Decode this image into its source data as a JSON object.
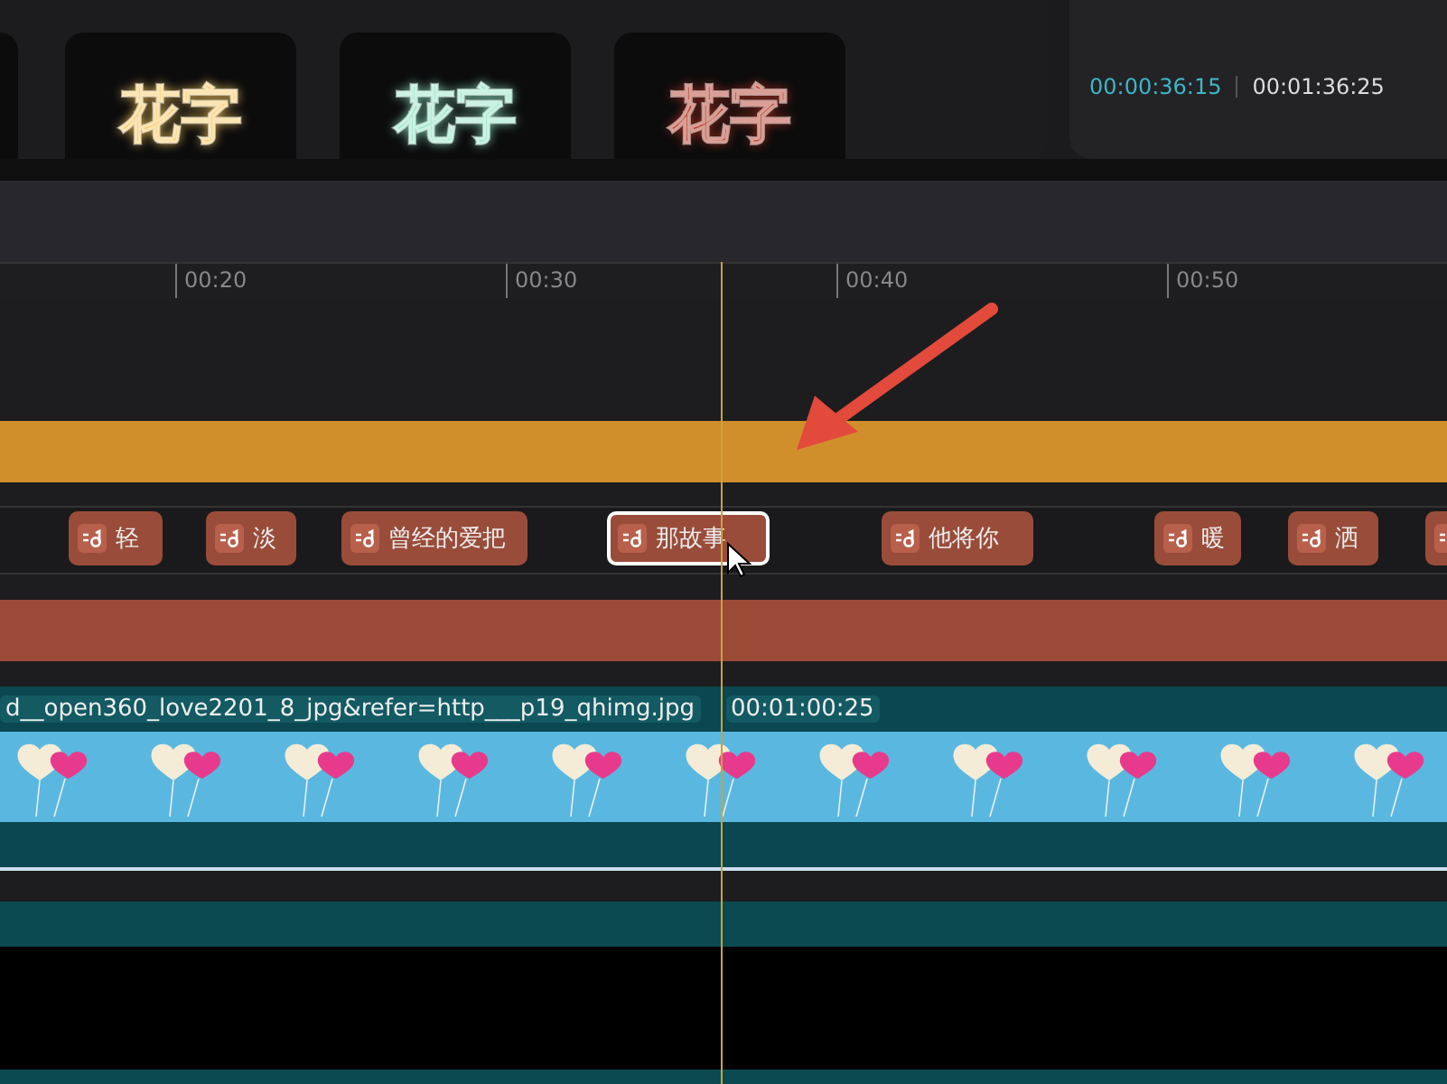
{
  "presets": [
    {
      "label": "花字",
      "color": "#f7c860"
    },
    {
      "label": "花字",
      "color": "#8fe3c4"
    },
    {
      "label": "花字",
      "color": "#b0321f"
    }
  ],
  "timecode": {
    "current": "00:00:36:15",
    "total": "00:01:36:25"
  },
  "ruler": [
    "00:20",
    "00:30",
    "00:40",
    "00:50"
  ],
  "audio_clips": [
    {
      "label": "轻",
      "selected": false
    },
    {
      "label": "淡",
      "selected": false
    },
    {
      "label": "曾经的爱把",
      "selected": false
    },
    {
      "label": "那故事",
      "selected": true
    },
    {
      "label": "他将你",
      "selected": false
    },
    {
      "label": "暖",
      "selected": false
    },
    {
      "label": "洒",
      "selected": false
    },
    {
      "selected": false
    }
  ],
  "video_clip": {
    "filename": "d__open360_love2201_8_jpg&refer=http___p19_qhimg.jpg",
    "duration": "00:01:00:25"
  }
}
